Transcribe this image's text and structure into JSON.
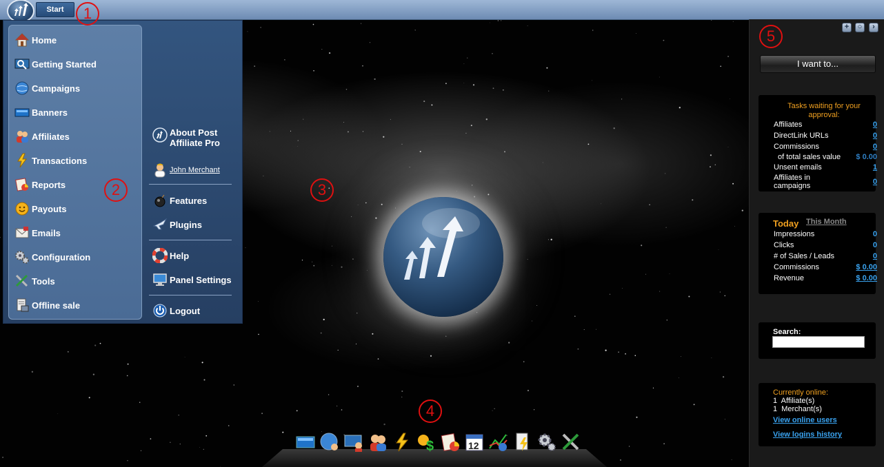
{
  "topbar": {
    "start_label": "Start"
  },
  "start_menu": {
    "left_items": [
      {
        "label": "Home",
        "icon": "home-icon"
      },
      {
        "label": "Getting Started",
        "icon": "magnifier-icon"
      },
      {
        "label": "Campaigns",
        "icon": "globe-icon"
      },
      {
        "label": "Banners",
        "icon": "banner-icon"
      },
      {
        "label": "Affiliates",
        "icon": "affiliates-icon"
      },
      {
        "label": "Transactions",
        "icon": "lightning-icon"
      },
      {
        "label": "Reports",
        "icon": "reports-icon"
      },
      {
        "label": "Payouts",
        "icon": "smiley-icon"
      },
      {
        "label": "Emails",
        "icon": "email-icon"
      },
      {
        "label": "Configuration",
        "icon": "gears-icon"
      },
      {
        "label": "Tools",
        "icon": "tools-icon"
      },
      {
        "label": "Offline sale",
        "icon": "offline-sale-icon"
      }
    ],
    "about_label_line1": "About Post",
    "about_label_line2": "Affiliate Pro",
    "user_name": "John Merchant",
    "features_label": "Features",
    "plugins_label": "Plugins",
    "help_label": "Help",
    "panel_settings_label": "Panel Settings",
    "logout_label": "Logout"
  },
  "right_panel": {
    "i_want_label": "I want to...",
    "tasks": {
      "title": "Tasks waiting for your approval:",
      "rows": [
        {
          "label": "Affiliates",
          "value": "0"
        },
        {
          "label": "DirectLink URLs",
          "value": "0"
        },
        {
          "label": "Commissions",
          "value": "0"
        }
      ],
      "total_sales_label": "of total sales value",
      "total_sales_value": "$ 0.00",
      "rows2": [
        {
          "label": "Unsent emails",
          "value": "1"
        }
      ],
      "affiliates_in_campaigns_line1": "Affiliates in",
      "affiliates_in_campaigns_line2": "campaigns",
      "affiliates_in_campaigns_value": "0"
    },
    "stats": {
      "today_tab": "Today",
      "month_tab": "This Month",
      "rows": [
        {
          "label": "Impressions",
          "value": "0"
        },
        {
          "label": "Clicks",
          "value": "0"
        },
        {
          "label": "# of Sales / Leads",
          "value": "0"
        },
        {
          "label": "Commissions",
          "value": "$ 0.00"
        },
        {
          "label": "Revenue",
          "value": "$ 0.00"
        }
      ]
    },
    "search": {
      "label": "Search:",
      "value": ""
    },
    "online": {
      "title": "Currently online:",
      "affiliates": "1  Affiliate(s)",
      "merchants": "1  Merchant(s)",
      "view_online": "View online users",
      "view_logins": "View logins history"
    }
  },
  "annotations": [
    "1",
    "2",
    "3",
    "4",
    "5"
  ],
  "colors": {
    "accent_blue": "#3aa3f0",
    "orange": "#f0a020",
    "annotation_red": "#e01010"
  }
}
